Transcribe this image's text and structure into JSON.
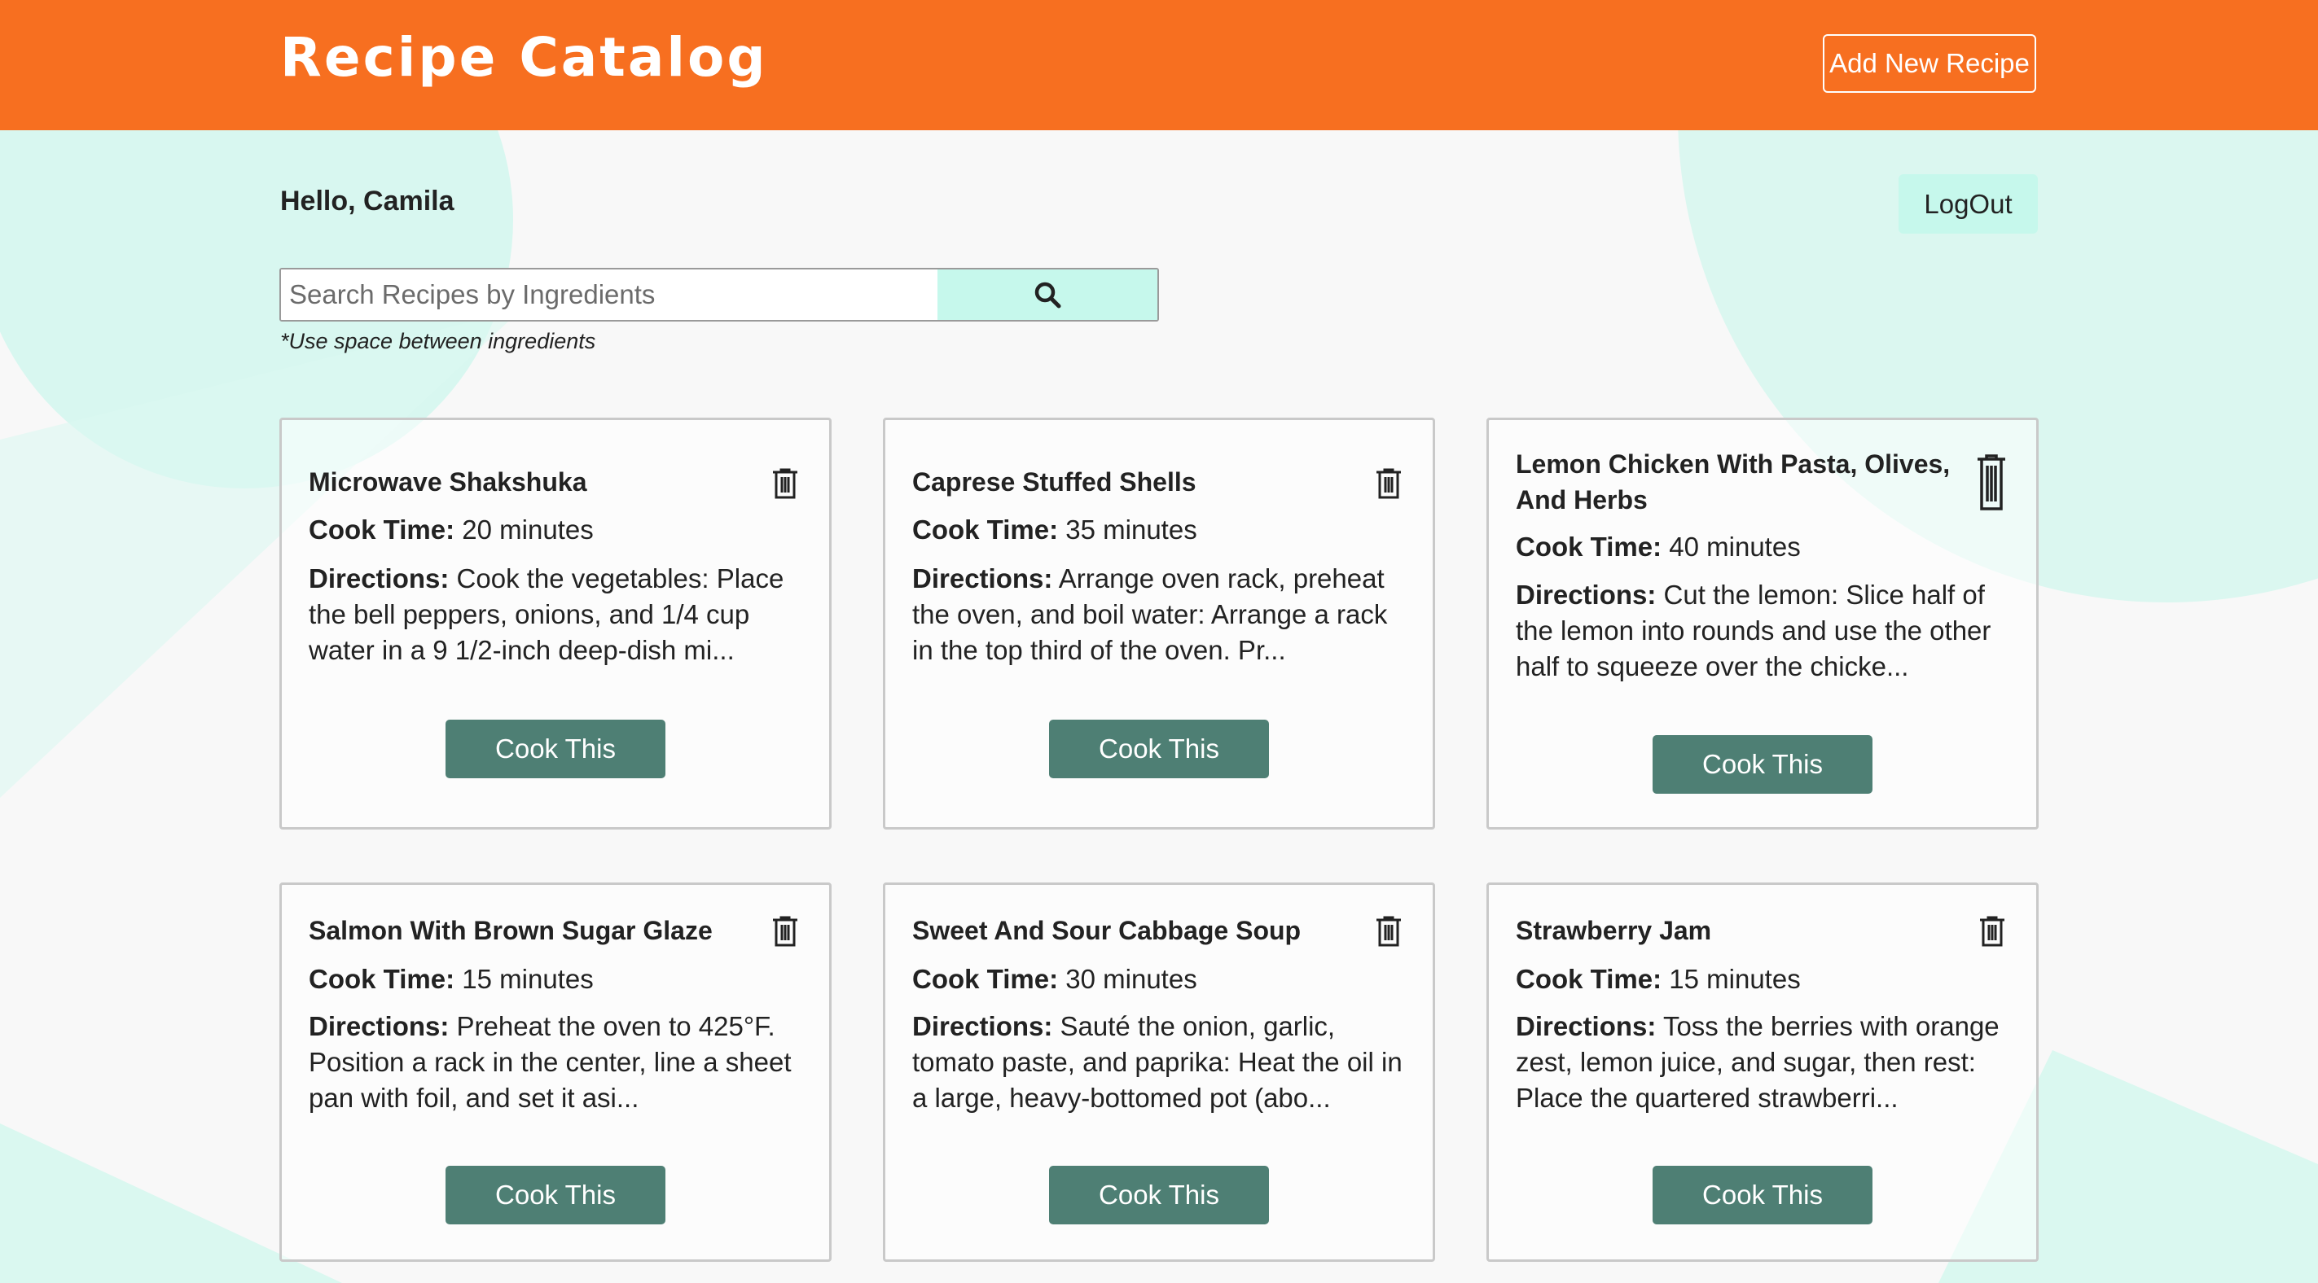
{
  "header": {
    "brand": "Recipe Catalog",
    "add_button": "Add New Recipe"
  },
  "user": {
    "greeting": "Hello, Camila",
    "logout": "LogOut"
  },
  "search": {
    "placeholder": "Search Recipes by Ingredients",
    "hint": "*Use space between ingredients",
    "icon": "search-icon"
  },
  "labels": {
    "cook_time": "Cook Time:",
    "directions": "Directions:",
    "cook_button": "Cook This"
  },
  "recipes": [
    {
      "title": "Microwave Shakshuka",
      "cook_time": "20 minutes",
      "directions": "Cook the vegetables: Place the bell peppers, onions, and 1/4 cup water in a 9 1/2-inch deep-dish mi..."
    },
    {
      "title": "Caprese Stuffed Shells",
      "cook_time": "35 minutes",
      "directions": "Arrange oven rack, preheat the oven, and boil water: Arrange a rack in the top third of the oven. Pr..."
    },
    {
      "title": "Lemon Chicken With Pasta, Olives, And Herbs",
      "cook_time": "40 minutes",
      "directions": "Cut the lemon: Slice half of the lemon into rounds and use the other half to squeeze over the chicke..."
    },
    {
      "title": "Salmon With Brown Sugar Glaze",
      "cook_time": "15 minutes",
      "directions": "Preheat the oven to 425°F. Position a rack in the center, line a sheet pan with foil, and set it asi..."
    },
    {
      "title": "Sweet And Sour Cabbage Soup",
      "cook_time": "30 minutes",
      "directions": "Sauté the onion, garlic, tomato paste, and paprika: Heat the oil in a large, heavy-bottomed pot (abo..."
    },
    {
      "title": "Strawberry Jam",
      "cook_time": "15 minutes",
      "directions": "Toss the berries with orange zest, lemon juice, and sugar, then rest: Place the quartered strawberri..."
    }
  ],
  "colors": {
    "header": "#f76f20",
    "accent": "#c6f8ec",
    "button": "#4e7f74"
  }
}
